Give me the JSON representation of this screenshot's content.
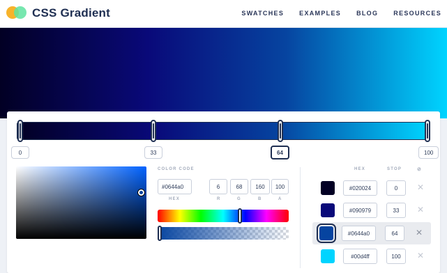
{
  "header": {
    "brand": "CSS Gradient",
    "nav": [
      "SWATCHES",
      "EXAMPLES",
      "BLOG",
      "RESOURCES"
    ]
  },
  "gradient": {
    "stops": [
      {
        "hex": "#020024",
        "stop": "0"
      },
      {
        "hex": "#090979",
        "stop": "33"
      },
      {
        "hex": "#0644a0",
        "stop": "64"
      },
      {
        "hex": "#00d4ff",
        "stop": "100"
      }
    ],
    "selected_index": 2
  },
  "picker": {
    "color_code_label": "COLOR CODE",
    "hex_value": "#0644a0",
    "hex_label": "HEX",
    "r_value": "6",
    "r_label": "R",
    "g_value": "68",
    "g_label": "G",
    "b_value": "160",
    "b_label": "B",
    "a_value": "100",
    "a_label": "A",
    "hue_level": 0.63,
    "alpha_level": 0.0,
    "sv_saturation": 0.96,
    "sv_value": 0.63
  },
  "stops_list": {
    "hex_header": "HEX",
    "stop_header": "STOP",
    "delete_header": "⊘",
    "delete_icon": "✕"
  },
  "colors": {
    "brand_dark": "#1f2f52",
    "logo_orange": "#f7b32b",
    "logo_green": "#5fe3a1"
  }
}
